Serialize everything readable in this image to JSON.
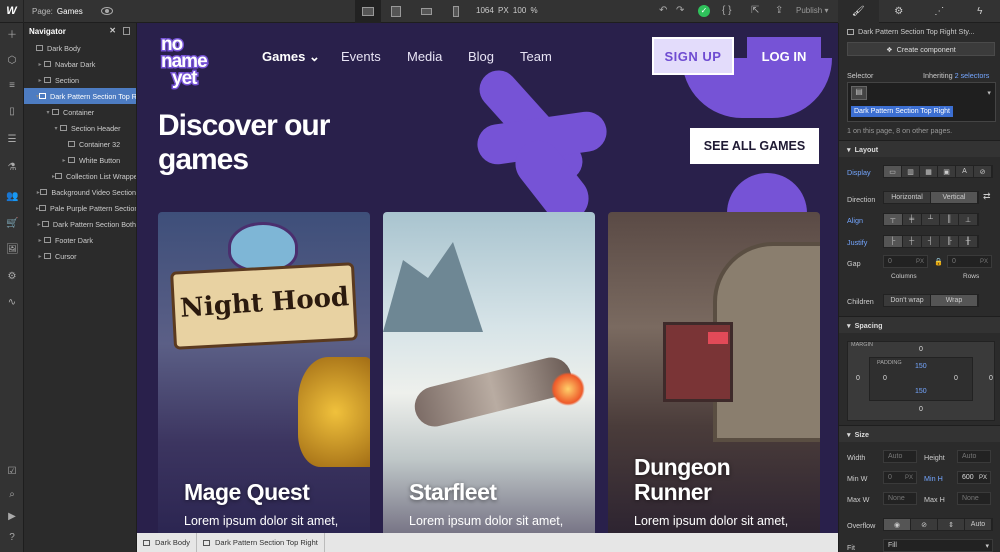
{
  "topbar": {
    "page_label": "Page:",
    "page_name": "Games",
    "size": "1064 PX  100 %",
    "publish": "Publish"
  },
  "navigator": {
    "title": "Navigator",
    "items": [
      {
        "label": "Dark Body",
        "indent": 0,
        "caret": ""
      },
      {
        "label": "Navbar Dark",
        "indent": 1,
        "caret": "▸"
      },
      {
        "label": "Section",
        "indent": 1,
        "caret": "▸"
      },
      {
        "label": "Dark Pattern Section Top Right",
        "indent": 1,
        "caret": "▾",
        "selected": true
      },
      {
        "label": "Container",
        "indent": 2,
        "caret": "▾"
      },
      {
        "label": "Section Header",
        "indent": 3,
        "caret": "▾"
      },
      {
        "label": "Container 32",
        "indent": 4,
        "caret": ""
      },
      {
        "label": "White Button",
        "indent": 4,
        "caret": "▸"
      },
      {
        "label": "Collection List Wrapper",
        "indent": 3,
        "caret": "▸"
      },
      {
        "label": "Background Video Section",
        "indent": 1,
        "caret": "▸"
      },
      {
        "label": "Pale Purple Pattern Section",
        "indent": 1,
        "caret": "▸"
      },
      {
        "label": "Dark Pattern Section Both",
        "indent": 1,
        "caret": "▸"
      },
      {
        "label": "Footer Dark",
        "indent": 1,
        "caret": "▸"
      },
      {
        "label": "Cursor",
        "indent": 1,
        "caret": "▸"
      }
    ]
  },
  "site": {
    "logo_l1": "no",
    "logo_l2": "name",
    "logo_l3": "yet",
    "nav": {
      "games": "Games",
      "events": "Events",
      "media": "Media",
      "blog": "Blog",
      "team": "Team"
    },
    "sign_up": "SIGN UP",
    "log_in": "LOG IN",
    "heading_l1": "Discover our",
    "heading_l2": "games",
    "see_all": "SEE ALL GAMES",
    "cards": [
      {
        "title_l1": "Mage Quest",
        "title_l2": "",
        "desc": "Lorem ipsum dolor sit amet,",
        "logo_text": "Night Hood"
      },
      {
        "title_l1": "Starfleet",
        "title_l2": "",
        "desc": "Lorem ipsum dolor sit amet,"
      },
      {
        "title_l1": "Dungeon",
        "title_l2": "Runner",
        "desc": "Lorem ipsum dolor sit amet,"
      }
    ],
    "colors": {
      "bg": "#29204b",
      "accent": "#7653d6",
      "signup_bg": "#e3dcfb"
    }
  },
  "breadcrumb": [
    "Dark Body",
    "Dark Pattern Section Top Right"
  ],
  "style_panel": {
    "element_name": "Dark Pattern Section Top Right Sty...",
    "create_component": "Create component",
    "selector_label": "Selector",
    "inheriting": "Inheriting",
    "inheriting_count": "2 selectors",
    "selector_tag": "Dark Pattern Section Top Right",
    "usage": "1 on this page, 8 on other pages.",
    "layout": "Layout",
    "display": "Display",
    "direction": "Direction",
    "horizontal": "Horizontal",
    "vertical": "Vertical",
    "align": "Align",
    "justify": "Justify",
    "gap": "Gap",
    "gap_col": "0",
    "gap_row": "0",
    "px": "PX",
    "columns": "Columns",
    "rows": "Rows",
    "children": "Children",
    "dont_wrap": "Don't wrap",
    "wrap": "Wrap",
    "spacing": "Spacing",
    "margin": "MARGIN",
    "padding": "PADDING",
    "margin_vals": {
      "top": "0",
      "right": "0",
      "bottom": "0",
      "left": "0"
    },
    "padding_vals": {
      "top": "150",
      "right": "0",
      "bottom": "150",
      "left": "0"
    },
    "size": "Size",
    "width": "Width",
    "height": "Height",
    "auto": "Auto",
    "min_w": "Min W",
    "min_h": "Min H",
    "min_w_val": "0",
    "min_h_val": "600",
    "max_w": "Max W",
    "max_h": "Max H",
    "none": "None",
    "overflow": "Overflow",
    "fit": "Fit",
    "fill": "Fill"
  }
}
